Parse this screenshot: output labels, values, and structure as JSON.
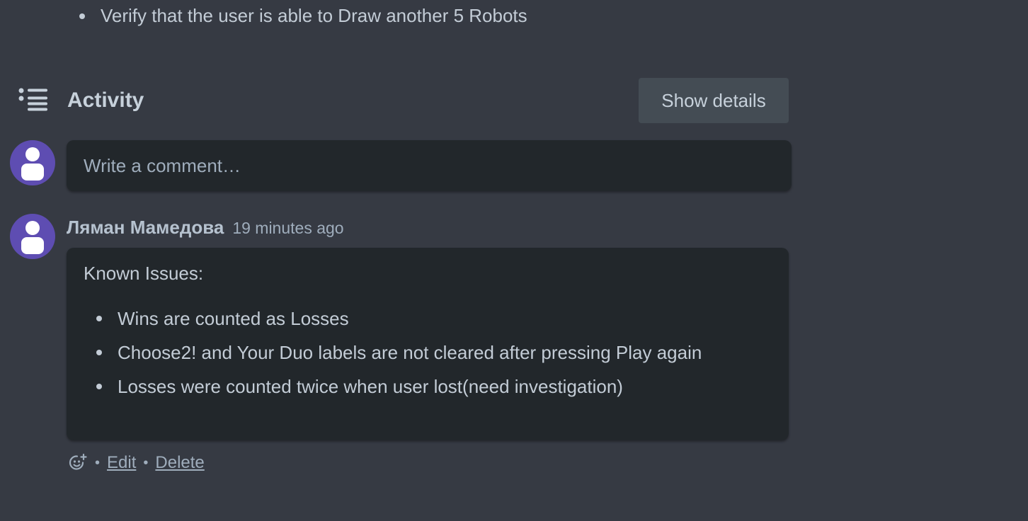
{
  "description_tail": {
    "bullet": "Verify that the user is able to Draw another 5 Robots"
  },
  "activity": {
    "title": "Activity",
    "icon": "activity-list-icon",
    "show_details_label": "Show details"
  },
  "new_comment": {
    "placeholder": "Write a comment…"
  },
  "comment": {
    "author": "Ляман Мамедова",
    "timestamp": "19 minutes ago",
    "intro": "Known Issues:",
    "items": [
      "Wins are counted as Losses",
      "Choose2! and Your Duo labels are not cleared after pressing Play again",
      "Losses were counted twice when user lost(need investigation)"
    ],
    "actions": {
      "reaction_icon": "add-reaction-icon",
      "separator": "•",
      "edit_label": "Edit",
      "delete_label": "Delete"
    }
  },
  "colors": {
    "background": "#363a43",
    "card": "#22272b",
    "button": "#444c54",
    "avatar": "#5e4db2",
    "text": "#b6c2cf",
    "muted_text": "#9fadbc"
  }
}
